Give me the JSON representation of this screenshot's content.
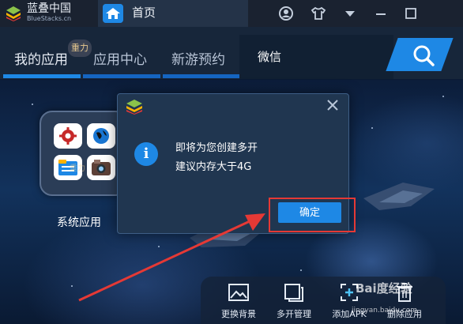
{
  "titlebar": {
    "brand_name": "蓝叠中国",
    "brand_sub": "BlueStacks.cn",
    "home_tab_label": "首页",
    "icons": [
      "user-icon",
      "tshirt-icon",
      "dropdown-icon",
      "minimize-icon",
      "maximize-icon"
    ]
  },
  "nav": {
    "tabs": [
      {
        "label": "我的应用",
        "active": true
      },
      {
        "label": "应用中心",
        "active": false
      },
      {
        "label": "新游预约",
        "active": false
      }
    ],
    "wechat_label": "微信",
    "tooltip_badge": "重力"
  },
  "desktop": {
    "folder_label": "系统应用",
    "folder_icons": [
      "settings-icon",
      "browser-globe-icon",
      "file-manager-icon",
      "camera-icon"
    ],
    "faint_badge": "重力"
  },
  "dialog": {
    "message_line1": "即将为您创建多开",
    "message_line2": "建议内存大于4G",
    "ok_label": "确定"
  },
  "toolbar": {
    "items": [
      {
        "label": "更换背景",
        "icon": "wallpaper-icon"
      },
      {
        "label": "多开管理",
        "icon": "multi-instance-icon"
      },
      {
        "label": "添加APK",
        "icon": "add-apk-icon"
      },
      {
        "label": "删除应用",
        "icon": "trash-icon"
      }
    ]
  },
  "watermark": {
    "text": "Bai度经验",
    "url": "jingyan.baidu.com"
  },
  "colors": {
    "accent": "#1e88e5",
    "highlight": "#e53935",
    "titlebar": "#1a2230",
    "navbar": "#17263a"
  }
}
